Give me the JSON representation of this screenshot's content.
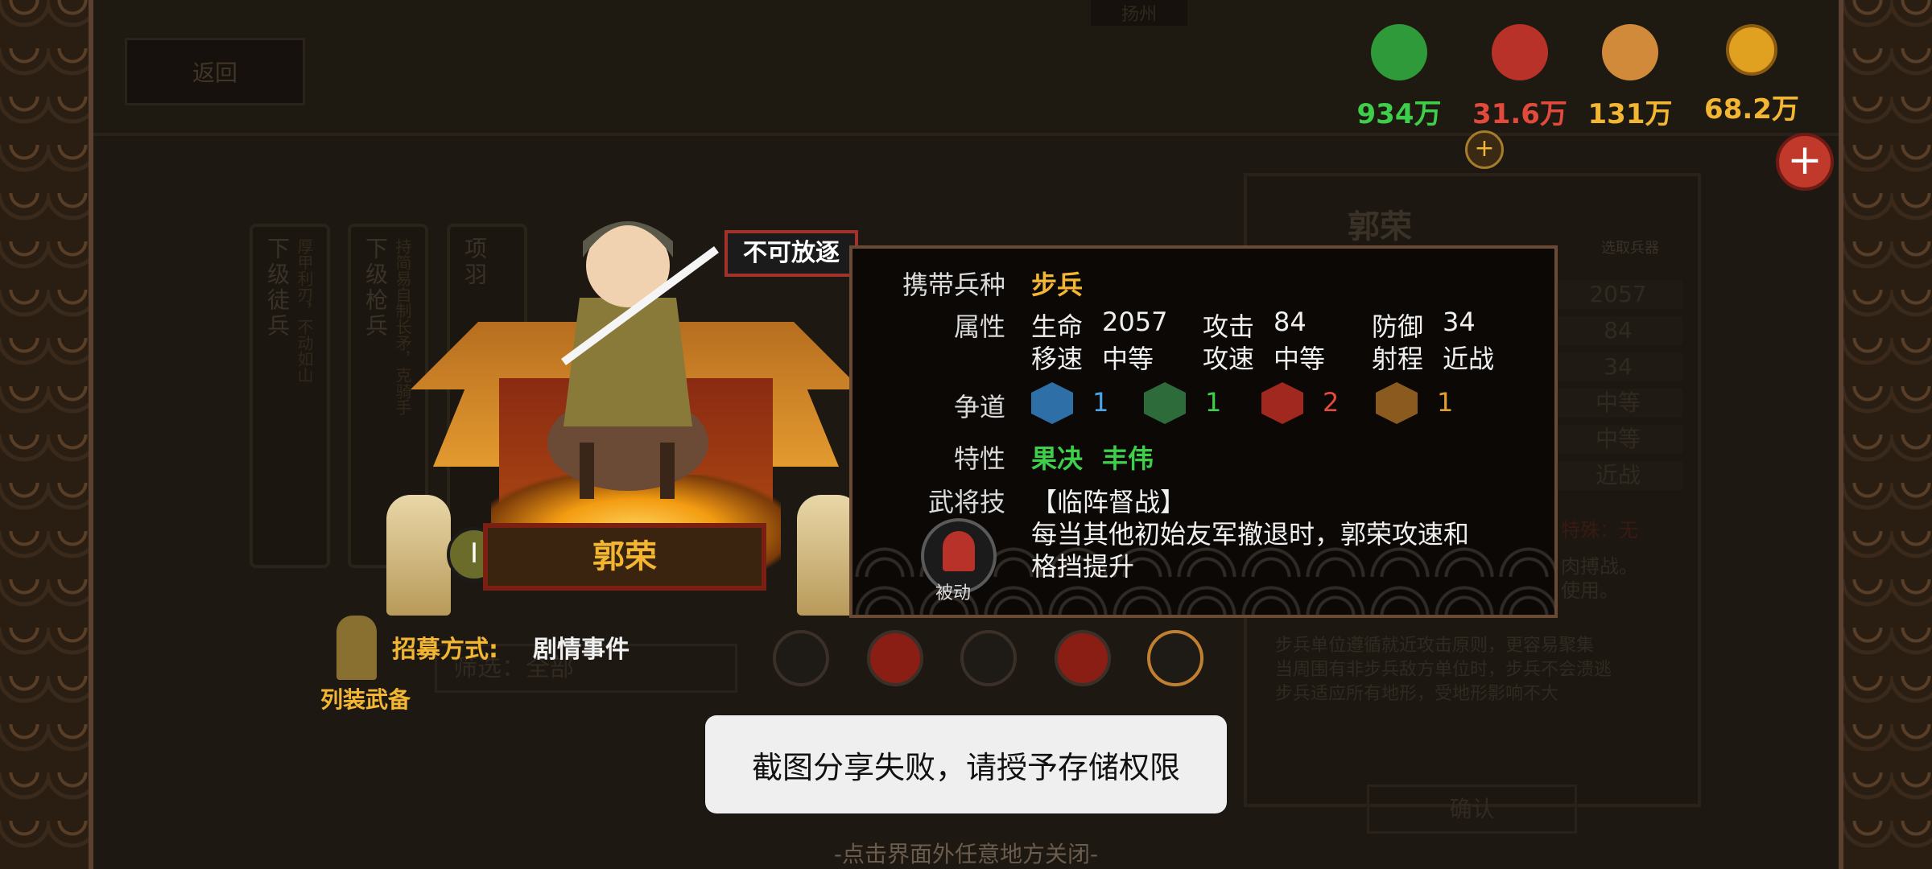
{
  "topbar": {
    "back_label": "返回",
    "region_label": "扬州",
    "resources": [
      {
        "icon": "population-icon",
        "value": "934万",
        "color": "#3ecf4a"
      },
      {
        "icon": "army-icon",
        "value": "31.6万",
        "color": "#e24a3b"
      },
      {
        "icon": "food-icon",
        "value": "131万",
        "color": "#f2b632"
      },
      {
        "icon": "coin-icon",
        "value": "68.2万",
        "color": "#f2b632"
      }
    ]
  },
  "background_cards": [
    {
      "title": "下级徒兵",
      "desc": "厚甲利刃，不动如山"
    },
    {
      "title": "下级枪兵",
      "desc": "持简易自制长矛，克骑手"
    },
    {
      "title": "项羽",
      "desc": ""
    }
  ],
  "side_panel": {
    "name": "郭荣",
    "select_weapon": "选取兵器",
    "stats": [
      "2057",
      "84",
      "34",
      "中等",
      "中等",
      "近战"
    ],
    "special_label": "特殊：无",
    "note_lines": [
      "肉搏战。",
      "使用。"
    ],
    "desc_lines": [
      "步兵单位遵循就近攻击原则，更容易聚集",
      "当周围有非步兵敌方单位时，步兵不会溃逃",
      "步兵适应所有地形，受地形影响不大"
    ],
    "confirm_label": "确认"
  },
  "close_hint": "-点击界面外任意地方关闭-",
  "hero": {
    "name": "郭荣",
    "tier_label": "I",
    "badge": "不可放逐",
    "recruit_label": "招募方式:",
    "recruit_value": "剧情事件",
    "equip_label": "列装武备",
    "filter_label": "筛选：全部"
  },
  "details": {
    "troop_label": "携带兵种",
    "troop_value": "步兵",
    "attr_label": "属性",
    "attrs": [
      {
        "name": "生命",
        "value": "2057"
      },
      {
        "name": "攻击",
        "value": "84"
      },
      {
        "name": "防御",
        "value": "34"
      },
      {
        "name": "移速",
        "value": "中等"
      },
      {
        "name": "攻速",
        "value": "中等"
      },
      {
        "name": "射程",
        "value": "近战"
      }
    ],
    "faction_label": "争道",
    "factions": [
      {
        "icon": "water-icon",
        "value": "1",
        "color": "#2f6fa8",
        "text_color": "#4aa6e8"
      },
      {
        "icon": "leaf-icon",
        "value": "1",
        "color": "#2d6b3a",
        "text_color": "#3ecf4a"
      },
      {
        "icon": "fire-icon",
        "value": "2",
        "color": "#a0281e",
        "text_color": "#e24a3b"
      },
      {
        "icon": "mountain-icon",
        "value": "1",
        "color": "#8a5a1e",
        "text_color": "#e0a030"
      }
    ],
    "trait_label": "特性",
    "traits": [
      "果决",
      "丰伟"
    ],
    "skill_label": "武将技",
    "skill_name": "【临阵督战】",
    "skill_desc_1": "每当其他初始友军撤退时，郭荣攻速和",
    "skill_desc_2": "格挡提升",
    "skill_type": "被动"
  },
  "toast": "截图分享失败，请授予存储权限"
}
